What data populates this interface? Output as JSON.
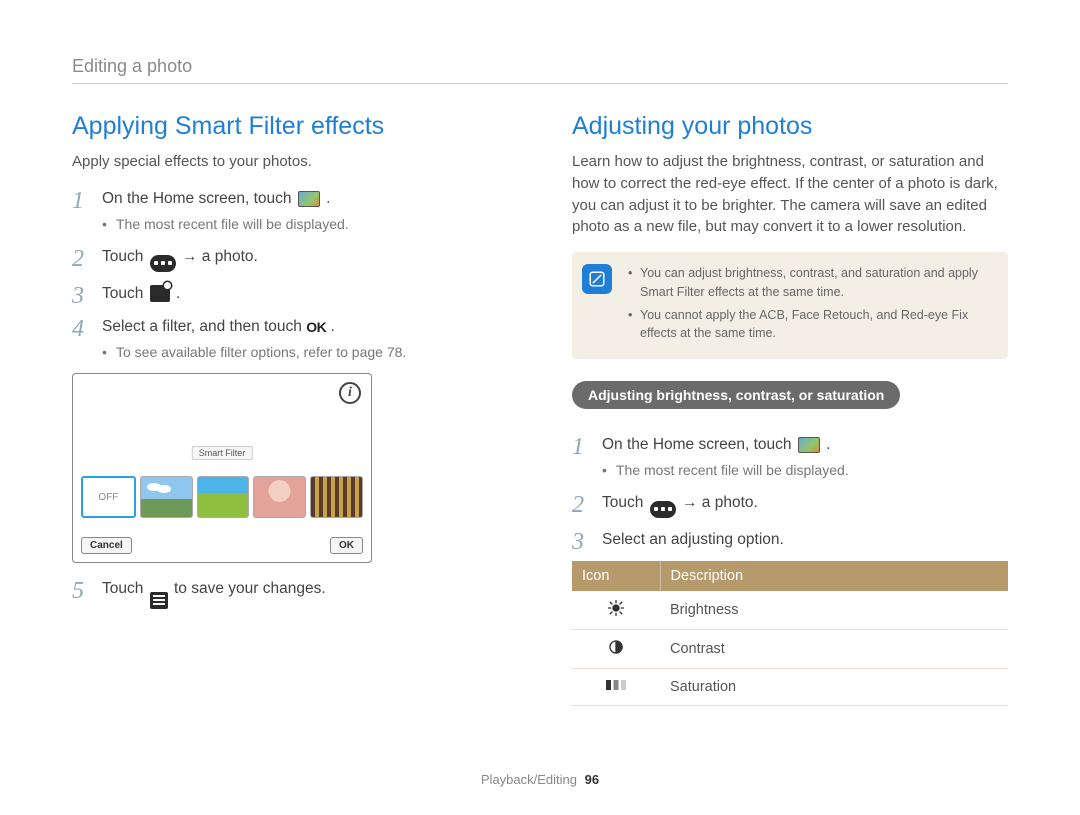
{
  "breadcrumb": "Editing a photo",
  "footer": {
    "section": "Playback/Editing",
    "page": "96"
  },
  "left": {
    "title": "Applying Smart Filter effects",
    "intro": "Apply special effects to your photos.",
    "steps": [
      {
        "num": "1",
        "text_before": "On the Home screen, touch ",
        "text_after": ".",
        "sub": [
          "The most recent file will be displayed."
        ]
      },
      {
        "num": "2",
        "text_before": "Touch ",
        "text_after": " → a photo."
      },
      {
        "num": "3",
        "text_before": "Touch ",
        "text_after": "."
      },
      {
        "num": "4",
        "text_before": "Select a filter, and then touch ",
        "ok": "OK",
        "text_after": " .",
        "sub": [
          "To see available filter options, refer to page 78."
        ]
      },
      {
        "num": "5",
        "text_before": "Touch ",
        "text_after": " to save your changes."
      }
    ],
    "screenshot": {
      "label": "Smart Filter",
      "off": "OFF",
      "cancel": "Cancel",
      "ok": "OK"
    }
  },
  "right": {
    "title": "Adjusting your photos",
    "intro": "Learn how to adjust the brightness, contrast, or saturation and how to correct the red-eye effect. If the center of a photo is dark, you can adjust it to be brighter. The camera will save an edited photo as a new file, but may convert it to a lower resolution.",
    "notes": [
      "You can adjust brightness, contrast, and saturation and apply Smart Filter effects at the same time.",
      "You cannot apply the ACB, Face Retouch, and Red-eye Fix effects at the same time."
    ],
    "subheading": "Adjusting brightness, contrast, or saturation",
    "steps": [
      {
        "num": "1",
        "text_before": "On the Home screen, touch ",
        "text_after": ".",
        "sub": [
          "The most recent file will be displayed."
        ]
      },
      {
        "num": "2",
        "text_before": "Touch ",
        "text_after": " → a photo."
      },
      {
        "num": "3",
        "text_before": "Select an adjusting option."
      }
    ],
    "table": {
      "head_icon": "Icon",
      "head_desc": "Description",
      "rows": [
        {
          "desc": "Brightness"
        },
        {
          "desc": "Contrast"
        },
        {
          "desc": "Saturation"
        }
      ]
    }
  }
}
